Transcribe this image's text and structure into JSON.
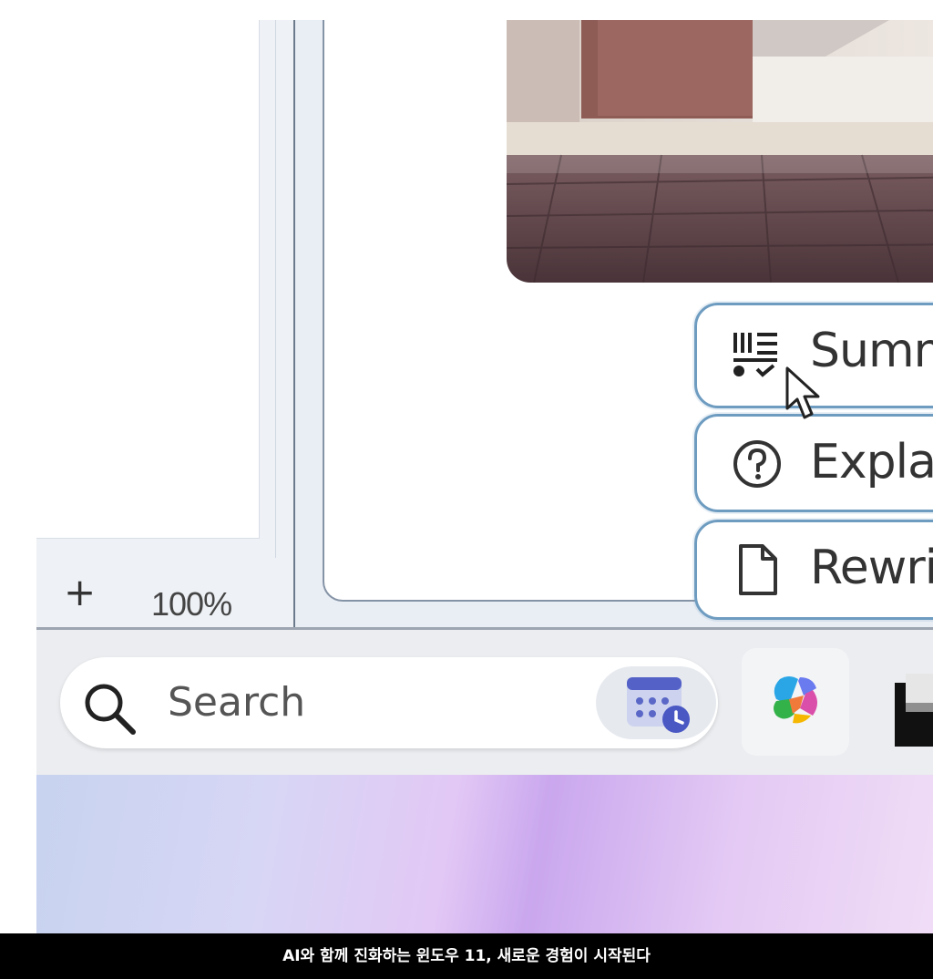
{
  "status_bar": {
    "zoom_in_icon": "plus-icon",
    "zoom_level": "100%"
  },
  "ai_menu": {
    "items": [
      {
        "label": "Summ",
        "icon": "summarize-icon"
      },
      {
        "label": "Explain",
        "icon": "question-circle-icon"
      },
      {
        "label": "Rewrit",
        "icon": "document-icon"
      }
    ]
  },
  "taskbar": {
    "search_placeholder": "Search",
    "search_icon": "search-icon",
    "calendar_icon": "calendar-clock-icon",
    "copilot_icon": "copilot-icon",
    "app_icon": "app-icon"
  },
  "caption": {
    "text": "AI와 함께 진화하는 윈도우 11, 새로운 경험이 시작된다"
  },
  "colors": {
    "menu_border": "#6e9cc0",
    "caption_bg": "#000000",
    "taskbar_bg": "#ebedf0"
  }
}
